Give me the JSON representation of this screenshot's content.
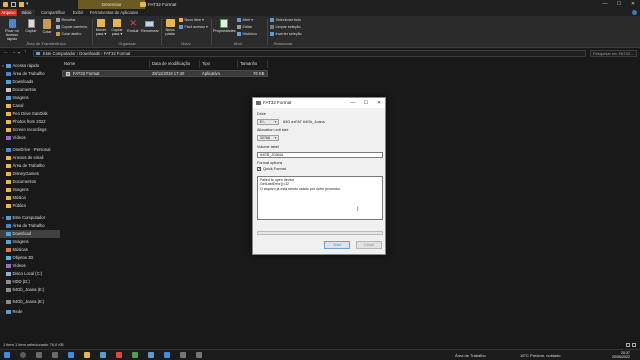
{
  "titlebar": {
    "context_tab": "Gerenciar",
    "title": "FAT32 Format",
    "minimize": "—",
    "maximize": "☐",
    "close": "✕"
  },
  "ribbon_tabs": [
    {
      "label": "Arquivo"
    },
    {
      "label": "Início"
    },
    {
      "label": "Compartilhar"
    },
    {
      "label": "Exibir"
    },
    {
      "label": "Ferramentas de Aplicativo"
    }
  ],
  "ribbon": {
    "pin_label": "Fixar no Acesso rápido",
    "copy_label": "Copiar",
    "paste_label": "Colar",
    "cut_label": "Recortar",
    "copy_path_label": "Copiar caminho",
    "paste_shortcut_label": "Colar atalho",
    "group_clipboard": "Área de Transferência",
    "move_label": "Mover para ▾",
    "copyto_label": "Copiar para ▾",
    "delete_label": "Excluir",
    "rename_label": "Renomear",
    "group_organize": "Organizar",
    "new_folder_label": "Nova pasta",
    "new_item_label": "Novo item ▾",
    "easy_access_label": "Fácil acesso ▾",
    "group_new": "Novo",
    "properties_label": "Propriedades",
    "open_label": "Abrir ▾",
    "edit_label": "Editar",
    "history_label": "Histórico",
    "group_open": "Abrir",
    "select_all_label": "Selecionar tudo",
    "select_none_label": "Limpar seleção",
    "invert_label": "Inverter seleção",
    "group_select": "Selecionar"
  },
  "address": {
    "path": "Este Computador  ›  Downloads  ›  FAT32 Format",
    "search_placeholder": "Pesquisar em FAT32..."
  },
  "navpane": {
    "items": [
      {
        "label": "Acesso rápido",
        "color": "#5a9bd8",
        "chev": "▾"
      },
      {
        "label": "Área de Trabalho",
        "color": "#4b86c9",
        "chev": ""
      },
      {
        "label": "Downloads",
        "color": "#4aa3df",
        "chev": ""
      },
      {
        "label": "Documentos",
        "color": "#c9c9c9",
        "chev": ""
      },
      {
        "label": "Imagens",
        "color": "#58a4d9",
        "chev": ""
      },
      {
        "label": "Canal",
        "color": "#e8b64a",
        "chev": ""
      },
      {
        "label": "Pen Drive SanDisk",
        "color": "#e8b64a",
        "chev": ""
      },
      {
        "label": "Photos from 2022",
        "color": "#e8b64a",
        "chev": ""
      },
      {
        "label": "Screen recordings",
        "color": "#e8b64a",
        "chev": ""
      },
      {
        "label": "Vídeos",
        "color": "#9b6fc4",
        "chev": ""
      },
      {
        "label": "OneDrive - Personal",
        "color": "#3d8ee0",
        "chev": "›"
      },
      {
        "label": "Anexos de email",
        "color": "#e8b64a",
        "chev": ""
      },
      {
        "label": "Área de Trabalho",
        "color": "#e8b64a",
        "chev": ""
      },
      {
        "label": "DisneyGames",
        "color": "#e8b64a",
        "chev": ""
      },
      {
        "label": "Documentos",
        "color": "#e8b64a",
        "chev": ""
      },
      {
        "label": "Imagens",
        "color": "#e8b64a",
        "chev": ""
      },
      {
        "label": "Música",
        "color": "#e8b64a",
        "chev": ""
      },
      {
        "label": "Público",
        "color": "#e8b64a",
        "chev": ""
      },
      {
        "label": "Este Computador",
        "color": "#5a9bd8",
        "chev": "▾"
      },
      {
        "label": "Área de Trabalho",
        "color": "#4b86c9",
        "chev": ""
      },
      {
        "label": "Download",
        "color": "#4aa3df",
        "chev": "",
        "selected": true
      },
      {
        "label": "Imagens",
        "color": "#58a4d9",
        "chev": ""
      },
      {
        "label": "Músicas",
        "color": "#e27a3f",
        "chev": ""
      },
      {
        "label": "Objetos 3D",
        "color": "#5fb4e0",
        "chev": ""
      },
      {
        "label": "Vídeos",
        "color": "#9b6fc4",
        "chev": ""
      },
      {
        "label": "Disco Local (C:)",
        "color": "#8fb0d1",
        "chev": ""
      },
      {
        "label": "HDD (D:)",
        "color": "#8c8c8c",
        "chev": ""
      },
      {
        "label": "64Gb_Joana (E:)",
        "color": "#8c8c8c",
        "chev": ""
      },
      {
        "label": "64Gb_Joana (E:)",
        "color": "#8c8c8c",
        "chev": "›"
      },
      {
        "label": "Rede",
        "color": "#5a9bd8",
        "chev": "›"
      }
    ]
  },
  "filelist": {
    "columns": [
      "Nome",
      "Data de modificação",
      "Tipo",
      "Tamanho"
    ],
    "rows": [
      {
        "name": "FAT32 Format",
        "date": "28/11/2019 17:40",
        "type": "Aplicativo",
        "size": "76 KB"
      }
    ]
  },
  "statusbar": {
    "text": "1 item   1 item selecionado  76,0 KB"
  },
  "taskbar": {
    "desktop_label": "Área de Trabalho",
    "weather": "16°C  Predom. nublado",
    "time": "20:37",
    "date": "20/06/2022"
  },
  "dialog": {
    "title": "FAT32 Format",
    "drive_label": "Drive",
    "drive_value": "E:\\",
    "drive_info": "63G exFAT 64Gb_Joana",
    "alloc_label": "Allocation unit size",
    "alloc_value": "32768",
    "volume_label": "Volume label",
    "volume_value": "64GB_JOANA",
    "format_options_label": "Format options",
    "quick_format_label": "Quick Format",
    "quick_format_checked": "✓",
    "log_text": "Failed to open device\nGetLastError()=32\nO arquivo já está sendo usado por outro processo.",
    "start_label": "Start",
    "close_label": "Close"
  }
}
